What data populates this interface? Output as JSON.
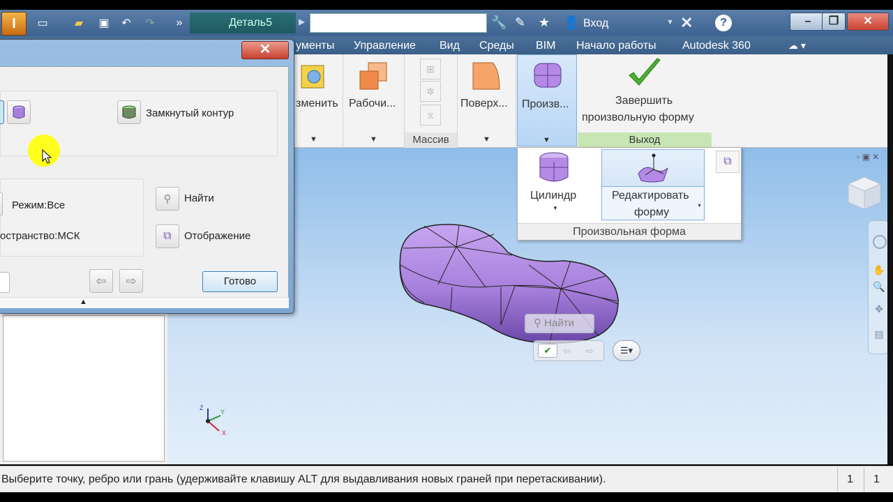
{
  "titlebar": {
    "doc_tab": "Деталь5",
    "login": "Вход"
  },
  "ribbon_tabs": [
    "ументы",
    "Управление",
    "Вид",
    "Среды",
    "BIM",
    "Начало работы",
    "Autodesk 360"
  ],
  "ribbon": {
    "btn_izmenit": "зменить",
    "btn_rabochi": "Рабочи...",
    "group_massiv": "Массив",
    "btn_poverh": "Поверх...",
    "btn_proizv": "Произв...",
    "btn_finish_line1": "Завершить",
    "btn_finish_line2": "произвольную форму",
    "group_exit": "Выход"
  },
  "dropdown": {
    "cylinder": "Цилиндр",
    "edit_line1": "Редактировать",
    "edit_line2": "форму",
    "footer": "Произвольная форма"
  },
  "dialog": {
    "closed_contour": "Замкнутый контур",
    "mode": "Режим:Все",
    "space": "остранство:МСК",
    "find": "Найти",
    "display": "Отображение",
    "done": "Готово"
  },
  "viewport": {
    "mini_find": "Найти",
    "triad_x": "X",
    "triad_y": "Y",
    "triad_z": "Z"
  },
  "statusbar": {
    "message": "Выберите точку, ребро или грань (удерживайте клавишу ALT для выдавливания новых граней при перетаскивании).",
    "num1": "1",
    "num2": "1"
  },
  "colors": {
    "accent_blue": "#3d6290",
    "model_purple": "#a77fdc",
    "finish_green": "#4caf32"
  }
}
